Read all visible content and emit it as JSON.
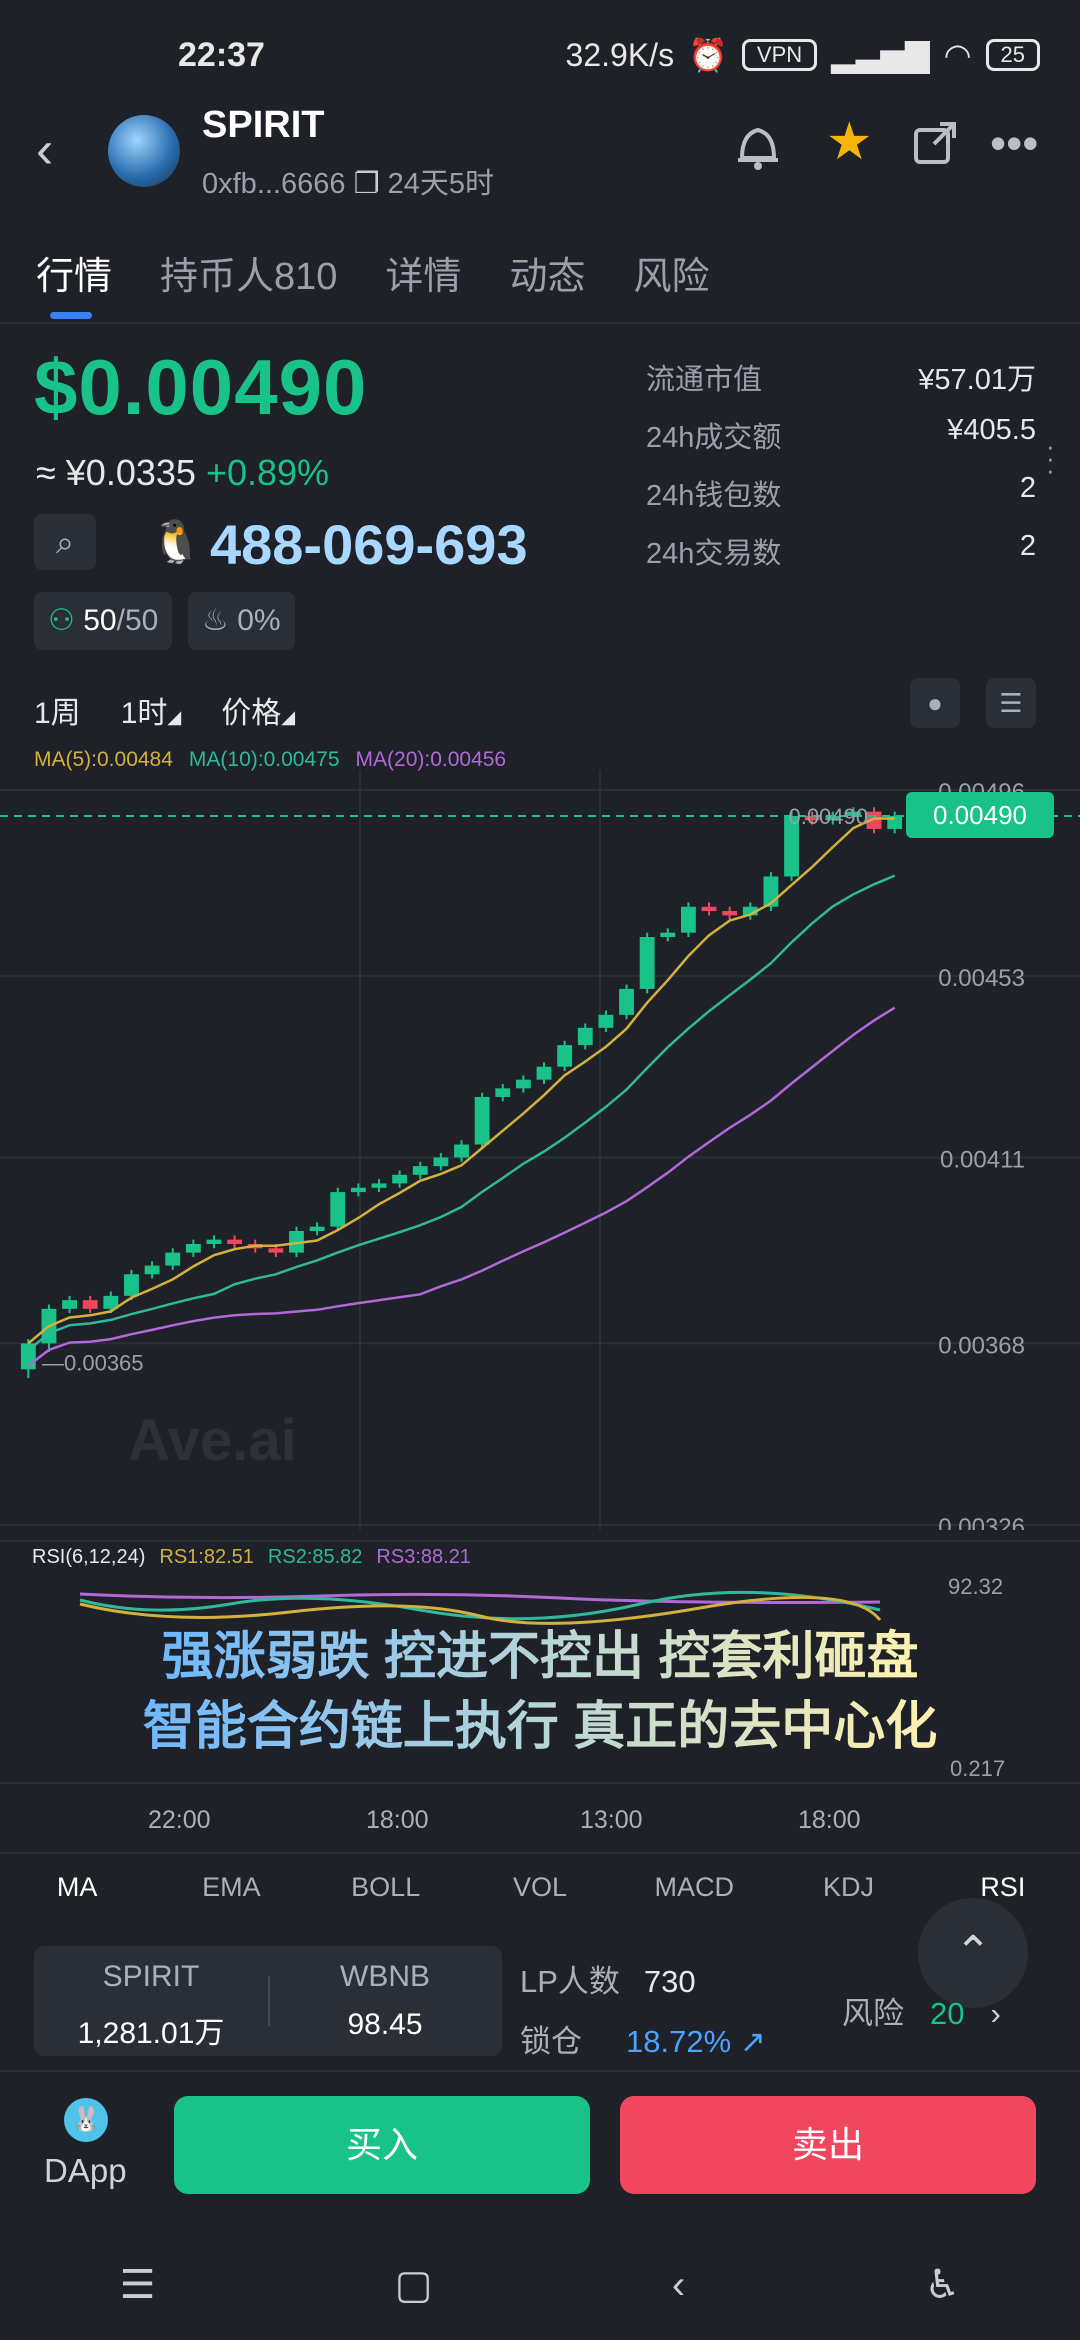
{
  "status_bar": {
    "time": "22:37",
    "speed": "32.9K/s",
    "vpn": "VPN",
    "battery": "25"
  },
  "header": {
    "title": "SPIRIT",
    "address": "0xfb...6666",
    "age": "24天5时"
  },
  "tabs": [
    {
      "label": "行情",
      "active": true
    },
    {
      "label": "持币人810",
      "active": false
    },
    {
      "label": "详情",
      "active": false
    },
    {
      "label": "动态",
      "active": false
    },
    {
      "label": "风险",
      "active": false
    }
  ],
  "price": {
    "usd": "$0.00490",
    "approx_prefix": "≈",
    "cny": "¥0.0335",
    "change": "+0.89%",
    "qq_number": "488-069-693",
    "chip_holders_value": "50",
    "chip_holders_total": "/50",
    "chip_tax": "0%"
  },
  "stats": [
    {
      "label": "流通市值",
      "value": "¥57.01万"
    },
    {
      "label": "24h成交额",
      "value": "¥405.5"
    },
    {
      "label": "24h钱包数",
      "value": "2"
    },
    {
      "label": "24h交易数",
      "value": "2"
    }
  ],
  "timeframes": {
    "week": "1周",
    "hour": "1时",
    "price_mode": "价格"
  },
  "ma_legend": [
    {
      "label": "MA(5):0.00484",
      "color": "#d4b13c"
    },
    {
      "label": "MA(10):0.00475",
      "color": "#2fb99a"
    },
    {
      "label": "MA(20):0.00456",
      "color": "#b268d8"
    }
  ],
  "chart_data": {
    "type": "candlestick",
    "y_ticks": [
      "0.00496",
      "0.00453",
      "0.00411",
      "0.00368",
      "0.00326"
    ],
    "ylim": [
      0.00326,
      0.00496
    ],
    "current_price": "0.00490",
    "last_line_label": "0.00490",
    "low_label": "0.00365",
    "x_ticks": [
      "22:00",
      "18:00",
      "13:00",
      "18:00"
    ],
    "candles": [
      [
        0.00362,
        0.00368,
        0.0036,
        0.00369
      ],
      [
        0.00368,
        0.00376,
        0.00366,
        0.00377
      ],
      [
        0.00376,
        0.00378,
        0.00375,
        0.00379
      ],
      [
        0.00378,
        0.00376,
        0.00375,
        0.00379
      ],
      [
        0.00376,
        0.00379,
        0.00375,
        0.0038
      ],
      [
        0.00379,
        0.00384,
        0.00378,
        0.00385
      ],
      [
        0.00384,
        0.00386,
        0.00383,
        0.00387
      ],
      [
        0.00386,
        0.00389,
        0.00385,
        0.0039
      ],
      [
        0.00389,
        0.00391,
        0.00388,
        0.00392
      ],
      [
        0.00391,
        0.00392,
        0.0039,
        0.00393
      ],
      [
        0.00392,
        0.00391,
        0.0039,
        0.00393
      ],
      [
        0.00391,
        0.0039,
        0.00389,
        0.00392
      ],
      [
        0.0039,
        0.00389,
        0.00388,
        0.00391
      ],
      [
        0.00389,
        0.00394,
        0.00388,
        0.00395
      ],
      [
        0.00394,
        0.00395,
        0.00393,
        0.00396
      ],
      [
        0.00395,
        0.00403,
        0.00394,
        0.00404
      ],
      [
        0.00403,
        0.00404,
        0.00402,
        0.00405
      ],
      [
        0.00404,
        0.00405,
        0.00403,
        0.00406
      ],
      [
        0.00405,
        0.00407,
        0.00404,
        0.00408
      ],
      [
        0.00407,
        0.00409,
        0.00406,
        0.0041
      ],
      [
        0.00409,
        0.00411,
        0.00408,
        0.00412
      ],
      [
        0.00411,
        0.00414,
        0.0041,
        0.00415
      ],
      [
        0.00414,
        0.00425,
        0.00413,
        0.00426
      ],
      [
        0.00425,
        0.00427,
        0.00424,
        0.00428
      ],
      [
        0.00427,
        0.00429,
        0.00426,
        0.0043
      ],
      [
        0.00429,
        0.00432,
        0.00428,
        0.00433
      ],
      [
        0.00432,
        0.00437,
        0.00431,
        0.00438
      ],
      [
        0.00437,
        0.00441,
        0.00436,
        0.00442
      ],
      [
        0.00441,
        0.00444,
        0.0044,
        0.00445
      ],
      [
        0.00444,
        0.0045,
        0.00443,
        0.00451
      ],
      [
        0.0045,
        0.00462,
        0.00449,
        0.00463
      ],
      [
        0.00462,
        0.00463,
        0.00461,
        0.00464
      ],
      [
        0.00463,
        0.00469,
        0.00462,
        0.0047
      ],
      [
        0.00469,
        0.00468,
        0.00467,
        0.0047
      ],
      [
        0.00468,
        0.00467,
        0.00466,
        0.00469
      ],
      [
        0.00467,
        0.00469,
        0.00466,
        0.0047
      ],
      [
        0.00469,
        0.00476,
        0.00468,
        0.00477
      ],
      [
        0.00476,
        0.0049,
        0.00475,
        0.00491
      ],
      [
        0.0049,
        0.00489,
        0.00488,
        0.00491
      ],
      [
        0.00489,
        0.0049,
        0.00488,
        0.00491
      ],
      [
        0.0049,
        0.00491,
        0.00489,
        0.00492
      ],
      [
        0.00491,
        0.00487,
        0.00486,
        0.00492
      ],
      [
        0.00487,
        0.0049,
        0.00486,
        0.00491
      ]
    ]
  },
  "rsi": {
    "legend_label": "RSI(6,12,24)",
    "rs1": "RS1:82.51",
    "rs2": "RS2:85.82",
    "rs3": "RS3:88.21",
    "top_label": "92.32",
    "bottom_label": "0.217"
  },
  "banner": {
    "line1": "强涨弱跌 控进不控出 控套利砸盘",
    "line2": "智能合约链上执行 真正的去中心化"
  },
  "watermark": "Ave.ai",
  "indicator_tabs": [
    {
      "label": "MA",
      "active": true
    },
    {
      "label": "EMA",
      "active": false
    },
    {
      "label": "BOLL",
      "active": false
    },
    {
      "label": "VOL",
      "active": false
    },
    {
      "label": "MACD",
      "active": false
    },
    {
      "label": "KDJ",
      "active": false
    },
    {
      "label": "RSI",
      "active": true
    }
  ],
  "liquidity": {
    "token_name": "SPIRIT",
    "token_amount": "1,281.01万",
    "pair_name": "WBNB",
    "pair_amount": "98.45",
    "lp_label": "LP人数",
    "lp_count": "730",
    "lock_label": "锁仓",
    "lock_value": "18.72%",
    "risk_label": "风险",
    "risk_value": "20"
  },
  "bottom": {
    "dapp_label": "DApp",
    "buy_label": "买入",
    "sell_label": "卖出"
  },
  "colors": {
    "up": "#19c288",
    "down": "#f0465e",
    "accent": "#3b82f6"
  }
}
